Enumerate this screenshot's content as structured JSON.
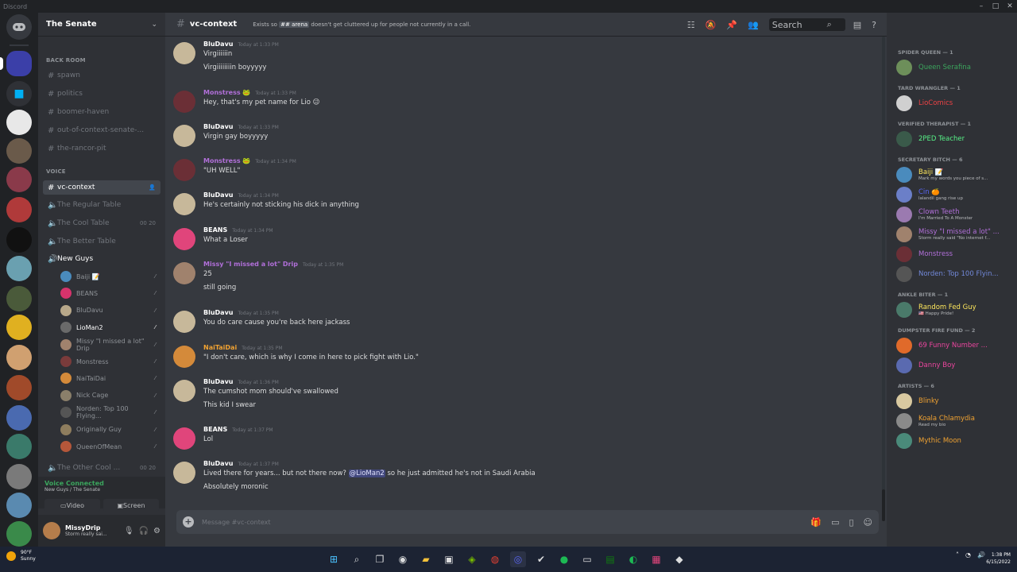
{
  "window": {
    "title": "Discord",
    "controls": [
      "–",
      "□",
      "✕"
    ]
  },
  "server": {
    "name": "The Senate"
  },
  "categories": {
    "back_room": "BACK ROOM",
    "voice": "VOICE"
  },
  "text_channels": [
    "spawn",
    "politics",
    "boomer-haven",
    "out-of-context-senate-...",
    "the-rancor-pit"
  ],
  "voice_channels": {
    "active": "vc-context",
    "regular": "The Regular Table",
    "cool": "The Cool Table",
    "cool_count": "00 20",
    "better": "The Better Table",
    "newguys": "New Guys",
    "other": "The Other Cool ...",
    "other_count": "00 20"
  },
  "voice_users": [
    {
      "name": "Baiji 📝",
      "color": "#4a8bbd"
    },
    {
      "name": "BEANS",
      "color": "#d6336c"
    },
    {
      "name": "BluDavu",
      "color": "#b8a88a"
    },
    {
      "name": "LioMan2",
      "color": "#6a6a6a"
    },
    {
      "name": "Missy \"I missed a lot\" Drip",
      "color": "#a0826d"
    },
    {
      "name": "Monstress",
      "color": "#7a3b3b"
    },
    {
      "name": "NaiTaiDai",
      "color": "#d48a3a"
    },
    {
      "name": "Nick Cage",
      "color": "#8a7f6a"
    },
    {
      "name": "Norden: Top 100 Flying...",
      "color": "#555"
    },
    {
      "name": "Originally Guy",
      "color": "#8e7d5e"
    },
    {
      "name": "QueenOfMean",
      "color": "#b5573a"
    }
  ],
  "voice_connected": {
    "status": "Voice Connected",
    "location": "New Guys / The Senate",
    "video": "Video",
    "screen": "Screen"
  },
  "user": {
    "name": "MissyDrip",
    "status": "Storm really sai..."
  },
  "header": {
    "channel": "vc-context",
    "topic_prefix": "Exists so",
    "topic_tag": "## arena",
    "topic_suffix": "doesn't get cluttered up for people not currently in a call.",
    "search_placeholder": "Search"
  },
  "messages": [
    {
      "author": "BluDavu",
      "color": "#ffffff",
      "time": "Today at 1:33 PM",
      "lines": [
        "Virgiiiiiin",
        "Virgiiiiiiiin boyyyyy"
      ],
      "av": "#c7b89a"
    },
    {
      "author": "Monstress 🐸",
      "color": "#b16fd9",
      "time": "Today at 1:33 PM",
      "lines": [
        "Hey, that's my pet name for Lio 😉"
      ],
      "av": "#6b2f36"
    },
    {
      "author": "BluDavu",
      "color": "#ffffff",
      "time": "Today at 1:33 PM",
      "lines": [
        "Virgin gay boyyyyy"
      ],
      "av": "#c7b89a"
    },
    {
      "author": "Monstress 🐸",
      "color": "#b16fd9",
      "time": "Today at 1:34 PM",
      "lines": [
        "\"UH WELL\""
      ],
      "av": "#6b2f36"
    },
    {
      "author": "BluDavu",
      "color": "#ffffff",
      "time": "Today at 1:34 PM",
      "lines": [
        "He's certainly not sticking his dick in anything"
      ],
      "av": "#c7b89a"
    },
    {
      "author": "BEANS",
      "color": "#ffffff",
      "time": "Today at 1:34 PM",
      "lines": [
        "What a Loser"
      ],
      "av": "#e0457b"
    },
    {
      "author": "Missy \"I missed a lot\" Drip",
      "color": "#b16fd9",
      "time": "Today at 1:35 PM",
      "lines": [
        "25",
        "still going"
      ],
      "av": "#a0826d"
    },
    {
      "author": "BluDavu",
      "color": "#ffffff",
      "time": "Today at 1:35 PM",
      "lines": [
        "You do care cause you're back here jackass"
      ],
      "av": "#c7b89a"
    },
    {
      "author": "NaiTaiDai",
      "color": "#f0a232",
      "time": "Today at 1:35 PM",
      "lines": [
        "\"I don't care, which is why I come in here to pick fight with Lio.\""
      ],
      "av": "#d48a3a"
    },
    {
      "author": "BluDavu",
      "color": "#ffffff",
      "time": "Today at 1:36 PM",
      "lines": [
        "The cumshot mom should've swallowed",
        "This kid I swear"
      ],
      "av": "#c7b89a"
    },
    {
      "author": "BEANS",
      "color": "#ffffff",
      "time": "Today at 1:37 PM",
      "lines": [
        "Lol"
      ],
      "av": "#e0457b"
    },
    {
      "author": "BluDavu",
      "color": "#ffffff",
      "time": "Today at 1:37 PM",
      "lines": [
        "Lived there for years... but not there now? @LioMan2 so he just admitted he's not in Saudi Arabia",
        "Absolutely moronic"
      ],
      "av": "#c7b89a"
    }
  ],
  "composer": {
    "placeholder": "Message #vc-context"
  },
  "member_groups": [
    {
      "title": "SPIDER QUEEN — 1",
      "members": [
        {
          "name": "Queen Serafina",
          "status": "",
          "color": "#3ba55d",
          "av": "#6d8f5a"
        }
      ]
    },
    {
      "title": "TARD WRANGLER — 1",
      "members": [
        {
          "name": "LioComics",
          "status": "",
          "color": "#ed4245",
          "av": "#d0d0d0"
        }
      ]
    },
    {
      "title": "VERIFIED THERAPIST — 1",
      "members": [
        {
          "name": "2PED Teacher",
          "status": "",
          "color": "#57f287",
          "av": "#3a5a4a"
        }
      ]
    },
    {
      "title": "SECRETARY BITCH — 6",
      "members": [
        {
          "name": "Baiji 📝",
          "status": "Mark my words you piece of s...",
          "color": "#fee75c",
          "av": "#4a8bbd"
        },
        {
          "name": "Cin 🍊",
          "status": "lalandil gang rise up",
          "color": "#5865f2",
          "av": "#6b7fc8"
        },
        {
          "name": "Clown Teeth",
          "status": "I'm Married To A Monster",
          "color": "#b16fd9",
          "av": "#9b7ab0"
        },
        {
          "name": "Missy \"I missed a lot\" ...",
          "status": "Storm really said \"No internet f...",
          "color": "#b16fd9",
          "av": "#a0826d"
        },
        {
          "name": "Monstress",
          "status": "",
          "color": "#b16fd9",
          "av": "#6b2f36"
        },
        {
          "name": "Norden: Top 100 Flyin...",
          "status": "",
          "color": "#7289da",
          "av": "#555555"
        }
      ]
    },
    {
      "title": "ANKLE BITER — 1",
      "members": [
        {
          "name": "Random Fed Guy",
          "status": "🇺🇸 Happy Pride!",
          "color": "#fee75c",
          "av": "#4a7a6a"
        }
      ]
    },
    {
      "title": "DUMPSTER FIRE FUND — 2",
      "members": [
        {
          "name": "69 Funny Number ...",
          "status": "",
          "color": "#eb459e",
          "av": "#e06a2a"
        },
        {
          "name": "Danny Boy",
          "status": "",
          "color": "#eb459e",
          "av": "#5a6ab0"
        }
      ]
    },
    {
      "title": "ARTISTS — 6",
      "members": [
        {
          "name": "Blinky",
          "status": "",
          "color": "#f0a232",
          "av": "#d9c9a0"
        },
        {
          "name": "Koala Chlamydia",
          "status": "Read my bio",
          "color": "#f0a232",
          "av": "#8a8a8a"
        },
        {
          "name": "Mythic Moon",
          "status": "",
          "color": "#f0a232",
          "av": "#4a8a7a"
        }
      ]
    }
  ],
  "taskbar": {
    "temp": "90°F",
    "condition": "Sunny",
    "time": "1:38 PM",
    "date": "6/15/2022",
    "icons": [
      "windows-icon",
      "search-icon",
      "taskview-icon",
      "chat-icon",
      "folder-icon",
      "store-icon",
      "nvidia-icon",
      "chrome-icon",
      "discord-icon",
      "todo-icon",
      "spotify-icon",
      "terminal-icon",
      "xbox-icon",
      "spotify-green-icon",
      "photos-icon",
      "app-icon"
    ]
  },
  "colors": {
    "accent": "#5865f2",
    "online": "#3ba55d"
  }
}
